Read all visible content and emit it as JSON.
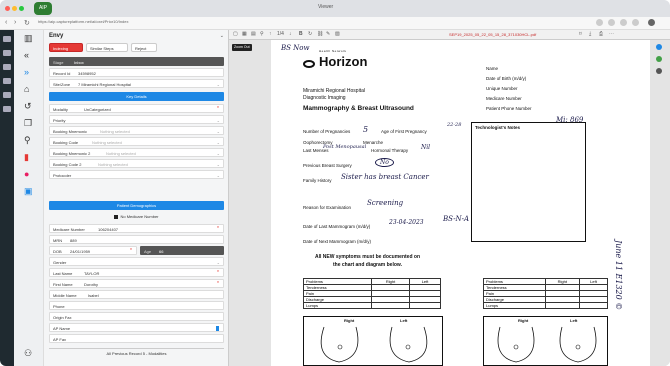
{
  "browser": {
    "tab_label": "AIP",
    "center_title": "Viewer",
    "url": "https://aip.captureplatform.net/ai/oxel/Prior10/Index"
  },
  "form": {
    "title": "Envy",
    "buttons": {
      "indexing": "Indexing",
      "similar": "Similar Steps",
      "reject": "Reject"
    },
    "stage_label": "Stage",
    "stage_value": "Inbox",
    "record_label": "Record Id",
    "record_value": "34598952",
    "site_label": "Site/Zone",
    "site_value": "7 Miramichi Regional Hospital",
    "key_details": "Key Details",
    "modality_label": "Modality",
    "modality_value": "UnCategorized",
    "priority_label": "Priority",
    "booking_mnemonic_label": "Booking Mnemonic",
    "booking_code_label": "Booking Code",
    "booking_mnemonic2_label": "Booking Mnemonic 2",
    "booking_code2_label": "Booking Code 2",
    "nothing_selected": "Nothing selected",
    "protocoler_label": "Protocoler",
    "patient_demographics": "Patient Demographics",
    "no_medicare": "No Medicare Number",
    "medicare_label": "Medicare Number",
    "medicare_value": "106204407",
    "mrn_label": "MRN",
    "mrn_value": "889",
    "dob_label": "DOB",
    "dob_value": "24/01/1959",
    "age_label": "Age",
    "age_value": "66",
    "gender_label": "Gender",
    "lastname_label": "Last Name",
    "lastname_value": "TAYLOR",
    "firstname_label": "First Name",
    "firstname_value": "Dorothy",
    "middlename_label": "Middle Name",
    "middlename_value": "Isabel",
    "phone_label": "Phone",
    "originfax_label": "Origin Fax",
    "apname_label": "AP Name",
    "apfax_label": "AP Fax",
    "footer_section": "All Previous Record 5 - Modalities"
  },
  "viewer": {
    "zoom_label": "Zoom Out",
    "page_indicator": "1/4",
    "pdf_filename": "SEP19_2025_05_22_05_15_28_371030HCL.pdf"
  },
  "document": {
    "brand": "Horizon",
    "brand_sub": "Health Network",
    "hospital": "Miramichi Regional Hospital",
    "department": "Diagnostic Imaging",
    "form_title": "Mammography & Breast Ultrasound",
    "name_label": "Name",
    "dob_label": "Date of Birth (m/d/y)",
    "unique_label": "Unique Number",
    "medicare_label": "Medicare Number",
    "phone_label": "Patient Phone Number",
    "pregnancies_label": "Number of Pregnancies",
    "first_preg_label": "Age of First Pregnancy",
    "oophorectomy_label": "Oophorectomy",
    "menarche_label": "Menarche",
    "last_menses_label": "Last Menses",
    "hormonal_label": "Hormonal Therapy",
    "prev_surgery_label": "Previous Breast Surgery",
    "family_history_label": "Family History",
    "reason_label": "Reason for Examination",
    "last_mammo_label": "Date of Last Mammogram (m/d/y)",
    "next_mammo_label": "Date of Next Mammogram (m/d/y)",
    "symptoms_note_1": "All NEW symptoms must be documented on",
    "symptoms_note_2": "the chart and diagram below.",
    "tech_notes": "Technologist's Notes",
    "problems": "Problems",
    "right": "Right",
    "left": "Left",
    "rows": [
      "Tenderness",
      "Pain",
      "Discharge",
      "Lumps"
    ],
    "diag_right": "Right",
    "diag_left": "Left",
    "hw_corner": "BS Now",
    "hw_mi": "Mi: 869",
    "hw_pregnancies": "5",
    "hw_first_preg": "22-28",
    "hw_last_menses": "Post Menopausal",
    "hw_hormonal": "Nil",
    "hw_prev_surgery": "No",
    "hw_family": "Sister has breast Cancer",
    "hw_reason": "Screening",
    "hw_last_mammo": "23-04-2023",
    "hw_bsna": "BS-N-A",
    "hw_side": "June 11 E1320 ©"
  }
}
